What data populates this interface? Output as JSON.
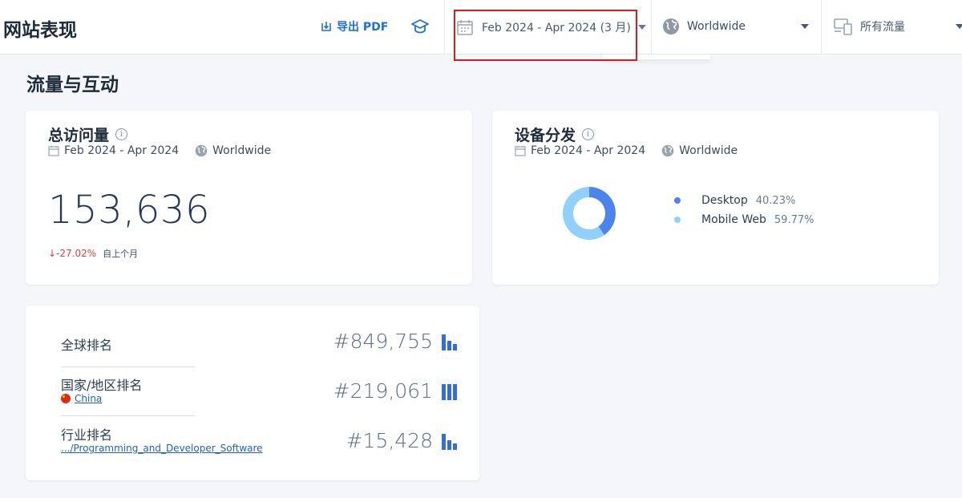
{
  "header": {
    "title": "网站表现",
    "export_label": "导出 PDF",
    "date_filter": "Feb 2024 - Apr 2024 (3 月)",
    "country_filter": "Worldwide",
    "traffic_filter": "所有流量"
  },
  "section_title": "流量与互动",
  "visits_card": {
    "title": "总访问量",
    "date_range": "Feb 2024 - Apr 2024",
    "region": "Worldwide",
    "value": "153,636",
    "change": "-27.02%",
    "change_suffix": "自上个月"
  },
  "device_card": {
    "title": "设备分发",
    "date_range": "Feb 2024 - Apr 2024",
    "region": "Worldwide",
    "segments": [
      {
        "label": "Desktop",
        "value": "40.23%",
        "share": 40.23,
        "color": "#4b84ec"
      },
      {
        "label": "Mobile Web",
        "value": "59.77%",
        "share": 59.77,
        "color": "#8fd1fb"
      }
    ]
  },
  "ranks": {
    "global": {
      "label": "全球排名",
      "value": "#849,755"
    },
    "country": {
      "label": "国家/地区排名",
      "sub": "China",
      "value": "#219,061"
    },
    "industry": {
      "label": "行业排名",
      "sub": ".../Programming_and_Developer_Software",
      "value": "#15,428"
    }
  }
}
